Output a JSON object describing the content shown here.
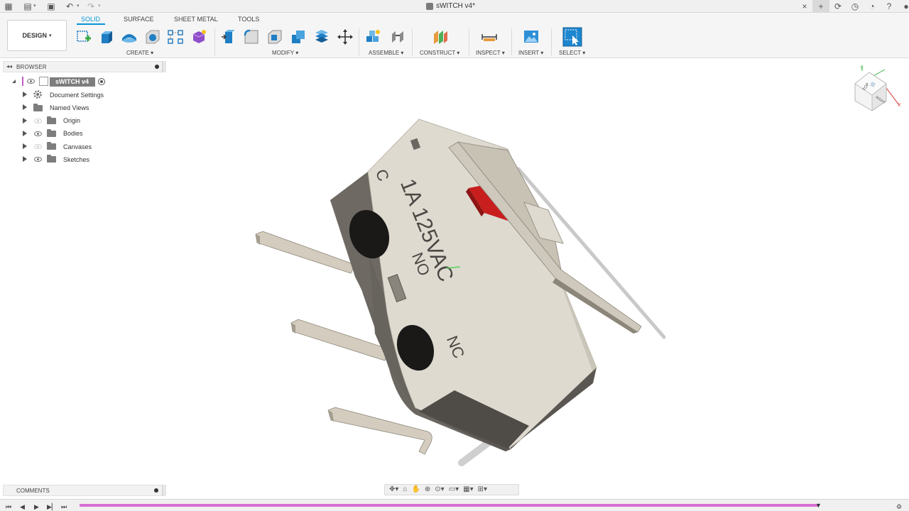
{
  "app": {
    "document_title": "sWITCH v4*"
  },
  "ribbon": {
    "workspace_label": "DESIGN",
    "tabs": [
      "SOLID",
      "SURFACE",
      "SHEET METAL",
      "TOOLS"
    ],
    "active_tab": "SOLID",
    "groups": [
      "CREATE",
      "MODIFY",
      "ASSEMBLE",
      "CONSTRUCT",
      "INSPECT",
      "INSERT",
      "SELECT"
    ]
  },
  "browser": {
    "title": "BROWSER",
    "root": "sWITCH v4",
    "items": [
      {
        "label": "Document Settings",
        "icon": "gear-icon",
        "visible": null
      },
      {
        "label": "Named Views",
        "icon": "folder-icon",
        "visible": null
      },
      {
        "label": "Origin",
        "icon": "folder-icon",
        "visible": false
      },
      {
        "label": "Bodies",
        "icon": "folder-icon",
        "visible": true
      },
      {
        "label": "Canvases",
        "icon": "folder-icon",
        "visible": false
      },
      {
        "label": "Sketches",
        "icon": "folder-icon",
        "visible": true
      }
    ]
  },
  "comments": {
    "title": "COMMENTS"
  },
  "model": {
    "markings": [
      "C",
      "1A 125VAC",
      "NO",
      "NC"
    ],
    "colors": {
      "body_light": "#dedad0",
      "body_dark": "#6a6660",
      "actuator": "#c81e1e",
      "lever": "#cfc9bd",
      "pin": "#d4cdbf"
    }
  },
  "viewcube": {
    "faces": [
      "TOP",
      "FRONT",
      "RIGHT"
    ],
    "axes": [
      "X",
      "Y",
      "Z"
    ]
  },
  "colors": {
    "accent": "#0696d7",
    "timeline": "#d86fd3",
    "panel": "#f2f2f2"
  }
}
